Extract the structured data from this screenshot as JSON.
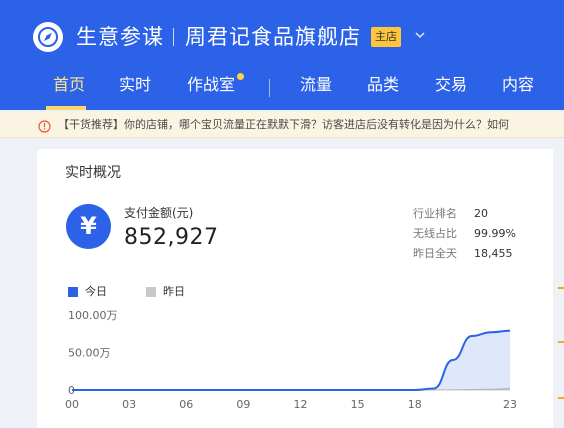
{
  "header": {
    "brand": "生意参谋",
    "shop_name": "周君记食品旗舰店",
    "shop_badge": "主店"
  },
  "nav": {
    "items": [
      {
        "label": "首页",
        "active": true
      },
      {
        "label": "实时",
        "active": false
      },
      {
        "label": "作战室",
        "active": false,
        "has_dot": true
      },
      {
        "label": "流量",
        "active": false
      },
      {
        "label": "品类",
        "active": false
      },
      {
        "label": "交易",
        "active": false
      },
      {
        "label": "内容",
        "active": false
      }
    ]
  },
  "notice": {
    "text": "【干货推荐】你的店铺，哪个宝贝流量正在默默下滑？访客进店后没有转化是因为什么？如何"
  },
  "overview": {
    "title": "实时概况",
    "payment_label": "支付金额(元)",
    "payment_value": "852,927",
    "stats": [
      {
        "label": "行业排名",
        "value": "20"
      },
      {
        "label": "无线占比",
        "value": "99.99%"
      },
      {
        "label": "昨日全天",
        "value": "18,455"
      }
    ],
    "legend": [
      {
        "label": "今日",
        "color": "#2b62e7"
      },
      {
        "label": "昨日",
        "color": "#c8c8c8"
      }
    ]
  },
  "colors": {
    "header_bg": "#2b62e7",
    "nav_active": "#ffe58f",
    "badge_bg": "#ffc53d",
    "today_line": "#2b62e7",
    "yesterday_line": "#c8c8c8",
    "notice_bg": "#fcf4e3"
  },
  "chart_data": {
    "type": "area",
    "x": [
      "00",
      "01",
      "02",
      "03",
      "04",
      "05",
      "06",
      "07",
      "08",
      "09",
      "10",
      "11",
      "12",
      "13",
      "14",
      "15",
      "16",
      "17",
      "18",
      "19",
      "20",
      "21",
      "22",
      "23"
    ],
    "xticks": [
      "00",
      "03",
      "06",
      "09",
      "12",
      "15",
      "18",
      "23"
    ],
    "yticks": [
      "100.00万",
      "50.00万",
      "0"
    ],
    "ylim": [
      0,
      1000000
    ],
    "series": [
      {
        "name": "今日",
        "values": [
          0,
          0,
          0,
          0,
          0,
          0,
          0,
          0,
          0,
          0,
          0,
          0,
          0,
          0,
          0,
          0,
          0,
          0,
          0,
          20000,
          400000,
          720000,
          770000,
          790000
        ]
      },
      {
        "name": "昨日",
        "values": [
          0,
          0,
          0,
          0,
          0,
          0,
          0,
          0,
          0,
          0,
          0,
          0,
          0,
          0,
          0,
          0,
          0,
          0,
          0,
          0,
          2000,
          5000,
          10000,
          18455
        ]
      }
    ]
  }
}
